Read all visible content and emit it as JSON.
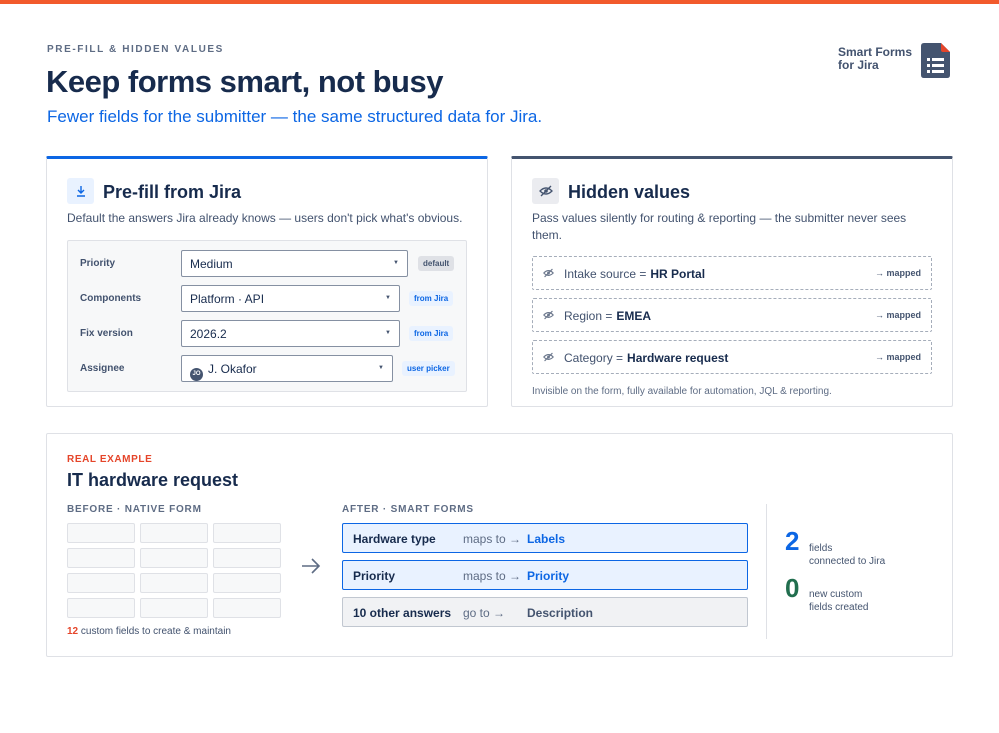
{
  "colors": {
    "accent": "#0c66e4",
    "topbar": "#f25a2c",
    "danger": "#e5452a",
    "success": "#216e4e",
    "text": "#172b4d"
  },
  "header": {
    "eyebrow": "PRE-FILL & HIDDEN VALUES",
    "title": "Keep forms smart, not busy",
    "subtitle": "Fewer fields for the submitter — the same structured data for Jira.",
    "brand_line1": "Smart Forms",
    "brand_line2": "for Jira",
    "brand_icon": "form-document-icon"
  },
  "prefill": {
    "icon": "download-icon",
    "title": "Pre-fill from Jira",
    "description": "Default the answers Jira already knows — users don't pick what's obvious.",
    "rows": [
      {
        "label": "Priority",
        "value": "Medium",
        "tag": "default"
      },
      {
        "label": "Components",
        "value": "Platform · API",
        "tag": "from Jira"
      },
      {
        "label": "Fix version",
        "value": "2026.2",
        "tag": "from Jira"
      },
      {
        "label": "Assignee",
        "value": "J. Okafor",
        "avatar": "JO",
        "tag": "user picker"
      }
    ]
  },
  "hidden": {
    "icon": "eye-off-icon",
    "title": "Hidden values",
    "description": "Pass values silently for routing & reporting — the submitter never sees them.",
    "rows": [
      {
        "label": "Intake source =",
        "value": "HR Portal",
        "status": "→ mapped"
      },
      {
        "label": "Region =",
        "value": "EMEA",
        "status": "→ mapped"
      },
      {
        "label": "Category =",
        "value": "Hardware request",
        "status": "→ mapped"
      }
    ],
    "footnote": "Invisible on the form, fully available for automation, JQL & reporting."
  },
  "example": {
    "eyebrow": "REAL EXAMPLE",
    "title": "IT hardware request",
    "before_label": "BEFORE · NATIVE FORM",
    "after_label": "AFTER · SMART FORMS",
    "native_count": "12",
    "native_note": "custom fields to create & maintain",
    "mappings": [
      {
        "field": "Hardware type",
        "verb": "maps to →",
        "target": "Labels"
      },
      {
        "field": "Priority",
        "verb": "maps to →",
        "target": "Priority"
      },
      {
        "field": "10 other answers",
        "verb": "go to →",
        "target": "Description"
      }
    ],
    "stats": [
      {
        "value": "2",
        "line1": "fields",
        "line2": "connected to Jira"
      },
      {
        "value": "0",
        "line1": "new custom",
        "line2": "fields created"
      }
    ]
  }
}
